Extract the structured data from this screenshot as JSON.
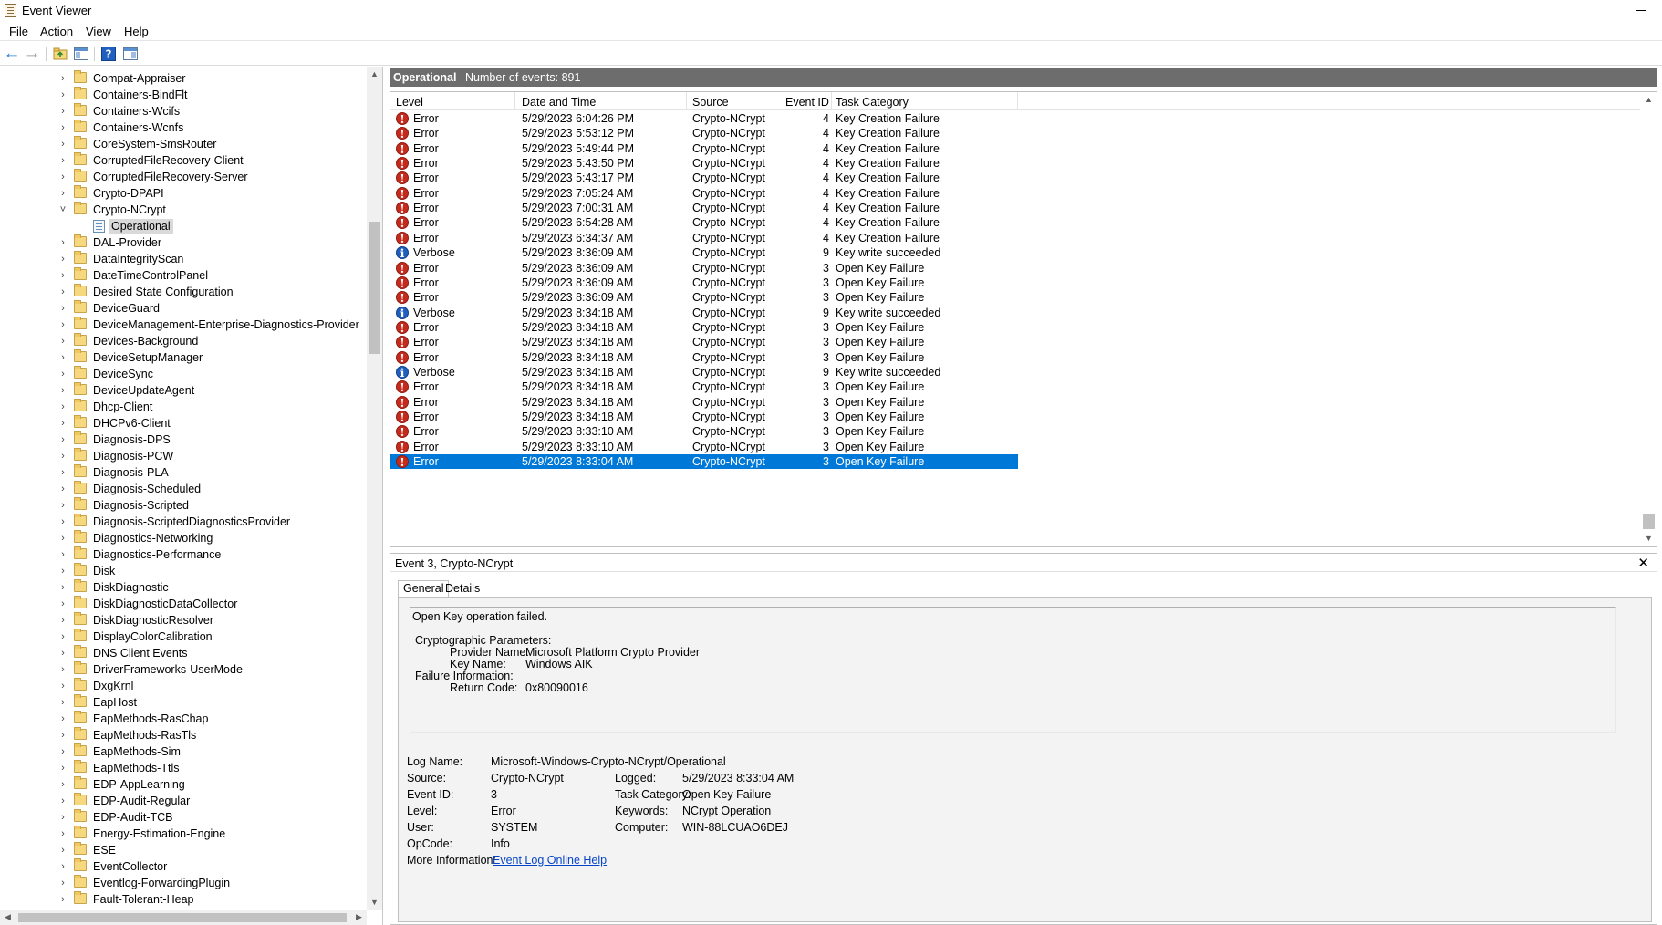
{
  "window": {
    "title": "Event Viewer"
  },
  "menu": [
    "File",
    "Action",
    "View",
    "Help"
  ],
  "toolbar": [
    "back-icon",
    "forward-icon",
    "up-folder-icon",
    "show-hide-tree-icon",
    "help-icon",
    "show-hide-action-pane-icon"
  ],
  "tree": {
    "items": [
      {
        "label": "Compat-Appraiser",
        "expanded": false
      },
      {
        "label": "Containers-BindFlt",
        "expanded": false
      },
      {
        "label": "Containers-Wcifs",
        "expanded": false
      },
      {
        "label": "Containers-Wcnfs",
        "expanded": false
      },
      {
        "label": "CoreSystem-SmsRouter",
        "expanded": false
      },
      {
        "label": "CorruptedFileRecovery-Client",
        "expanded": false
      },
      {
        "label": "CorruptedFileRecovery-Server",
        "expanded": false
      },
      {
        "label": "Crypto-DPAPI",
        "expanded": false
      },
      {
        "label": "Crypto-NCrypt",
        "expanded": true
      },
      {
        "label": "Operational",
        "child": true,
        "selected": true
      },
      {
        "label": "DAL-Provider",
        "expanded": false
      },
      {
        "label": "DataIntegrityScan",
        "expanded": false
      },
      {
        "label": "DateTimeControlPanel",
        "expanded": false
      },
      {
        "label": "Desired State Configuration",
        "expanded": false
      },
      {
        "label": "DeviceGuard",
        "expanded": false
      },
      {
        "label": "DeviceManagement-Enterprise-Diagnostics-Provider",
        "expanded": false
      },
      {
        "label": "Devices-Background",
        "expanded": false
      },
      {
        "label": "DeviceSetupManager",
        "expanded": false
      },
      {
        "label": "DeviceSync",
        "expanded": false
      },
      {
        "label": "DeviceUpdateAgent",
        "expanded": false
      },
      {
        "label": "Dhcp-Client",
        "expanded": false
      },
      {
        "label": "DHCPv6-Client",
        "expanded": false
      },
      {
        "label": "Diagnosis-DPS",
        "expanded": false
      },
      {
        "label": "Diagnosis-PCW",
        "expanded": false
      },
      {
        "label": "Diagnosis-PLA",
        "expanded": false
      },
      {
        "label": "Diagnosis-Scheduled",
        "expanded": false
      },
      {
        "label": "Diagnosis-Scripted",
        "expanded": false
      },
      {
        "label": "Diagnosis-ScriptedDiagnosticsProvider",
        "expanded": false
      },
      {
        "label": "Diagnostics-Networking",
        "expanded": false
      },
      {
        "label": "Diagnostics-Performance",
        "expanded": false
      },
      {
        "label": "Disk",
        "expanded": false
      },
      {
        "label": "DiskDiagnostic",
        "expanded": false
      },
      {
        "label": "DiskDiagnosticDataCollector",
        "expanded": false
      },
      {
        "label": "DiskDiagnosticResolver",
        "expanded": false
      },
      {
        "label": "DisplayColorCalibration",
        "expanded": false
      },
      {
        "label": "DNS Client Events",
        "expanded": false
      },
      {
        "label": "DriverFrameworks-UserMode",
        "expanded": false
      },
      {
        "label": "DxgKrnl",
        "expanded": false
      },
      {
        "label": "EapHost",
        "expanded": false
      },
      {
        "label": "EapMethods-RasChap",
        "expanded": false
      },
      {
        "label": "EapMethods-RasTls",
        "expanded": false
      },
      {
        "label": "EapMethods-Sim",
        "expanded": false
      },
      {
        "label": "EapMethods-Ttls",
        "expanded": false
      },
      {
        "label": "EDP-AppLearning",
        "expanded": false
      },
      {
        "label": "EDP-Audit-Regular",
        "expanded": false
      },
      {
        "label": "EDP-Audit-TCB",
        "expanded": false
      },
      {
        "label": "Energy-Estimation-Engine",
        "expanded": false
      },
      {
        "label": "ESE",
        "expanded": false
      },
      {
        "label": "EventCollector",
        "expanded": false
      },
      {
        "label": "Eventlog-ForwardingPlugin",
        "expanded": false
      },
      {
        "label": "Fault-Tolerant-Heap",
        "expanded": false
      }
    ]
  },
  "log": {
    "name": "Operational",
    "count_label": "Number of events: 891"
  },
  "columns": [
    "Level",
    "Date and Time",
    "Source",
    "Event ID",
    "Task Category"
  ],
  "events": [
    {
      "level": "Error",
      "datetime": "5/29/2023 6:04:26 PM",
      "source": "Crypto-NCrypt",
      "id": "4",
      "task": "Key Creation Failure"
    },
    {
      "level": "Error",
      "datetime": "5/29/2023 5:53:12 PM",
      "source": "Crypto-NCrypt",
      "id": "4",
      "task": "Key Creation Failure"
    },
    {
      "level": "Error",
      "datetime": "5/29/2023 5:49:44 PM",
      "source": "Crypto-NCrypt",
      "id": "4",
      "task": "Key Creation Failure"
    },
    {
      "level": "Error",
      "datetime": "5/29/2023 5:43:50 PM",
      "source": "Crypto-NCrypt",
      "id": "4",
      "task": "Key Creation Failure"
    },
    {
      "level": "Error",
      "datetime": "5/29/2023 5:43:17 PM",
      "source": "Crypto-NCrypt",
      "id": "4",
      "task": "Key Creation Failure"
    },
    {
      "level": "Error",
      "datetime": "5/29/2023 7:05:24 AM",
      "source": "Crypto-NCrypt",
      "id": "4",
      "task": "Key Creation Failure"
    },
    {
      "level": "Error",
      "datetime": "5/29/2023 7:00:31 AM",
      "source": "Crypto-NCrypt",
      "id": "4",
      "task": "Key Creation Failure"
    },
    {
      "level": "Error",
      "datetime": "5/29/2023 6:54:28 AM",
      "source": "Crypto-NCrypt",
      "id": "4",
      "task": "Key Creation Failure"
    },
    {
      "level": "Error",
      "datetime": "5/29/2023 6:34:37 AM",
      "source": "Crypto-NCrypt",
      "id": "4",
      "task": "Key Creation Failure"
    },
    {
      "level": "Verbose",
      "datetime": "5/29/2023 8:36:09 AM",
      "source": "Crypto-NCrypt",
      "id": "9",
      "task": "Key write succeeded"
    },
    {
      "level": "Error",
      "datetime": "5/29/2023 8:36:09 AM",
      "source": "Crypto-NCrypt",
      "id": "3",
      "task": "Open Key Failure"
    },
    {
      "level": "Error",
      "datetime": "5/29/2023 8:36:09 AM",
      "source": "Crypto-NCrypt",
      "id": "3",
      "task": "Open Key Failure"
    },
    {
      "level": "Error",
      "datetime": "5/29/2023 8:36:09 AM",
      "source": "Crypto-NCrypt",
      "id": "3",
      "task": "Open Key Failure"
    },
    {
      "level": "Verbose",
      "datetime": "5/29/2023 8:34:18 AM",
      "source": "Crypto-NCrypt",
      "id": "9",
      "task": "Key write succeeded"
    },
    {
      "level": "Error",
      "datetime": "5/29/2023 8:34:18 AM",
      "source": "Crypto-NCrypt",
      "id": "3",
      "task": "Open Key Failure"
    },
    {
      "level": "Error",
      "datetime": "5/29/2023 8:34:18 AM",
      "source": "Crypto-NCrypt",
      "id": "3",
      "task": "Open Key Failure"
    },
    {
      "level": "Error",
      "datetime": "5/29/2023 8:34:18 AM",
      "source": "Crypto-NCrypt",
      "id": "3",
      "task": "Open Key Failure"
    },
    {
      "level": "Verbose",
      "datetime": "5/29/2023 8:34:18 AM",
      "source": "Crypto-NCrypt",
      "id": "9",
      "task": "Key write succeeded"
    },
    {
      "level": "Error",
      "datetime": "5/29/2023 8:34:18 AM",
      "source": "Crypto-NCrypt",
      "id": "3",
      "task": "Open Key Failure"
    },
    {
      "level": "Error",
      "datetime": "5/29/2023 8:34:18 AM",
      "source": "Crypto-NCrypt",
      "id": "3",
      "task": "Open Key Failure"
    },
    {
      "level": "Error",
      "datetime": "5/29/2023 8:34:18 AM",
      "source": "Crypto-NCrypt",
      "id": "3",
      "task": "Open Key Failure"
    },
    {
      "level": "Error",
      "datetime": "5/29/2023 8:33:10 AM",
      "source": "Crypto-NCrypt",
      "id": "3",
      "task": "Open Key Failure"
    },
    {
      "level": "Error",
      "datetime": "5/29/2023 8:33:10 AM",
      "source": "Crypto-NCrypt",
      "id": "3",
      "task": "Open Key Failure"
    },
    {
      "level": "Error",
      "datetime": "5/29/2023 8:33:04 AM",
      "source": "Crypto-NCrypt",
      "id": "3",
      "task": "Open Key Failure",
      "selected": true
    }
  ],
  "details": {
    "header": "Event 3, Crypto-NCrypt",
    "tabs": [
      "General",
      "Details"
    ],
    "message": {
      "line1": "Open Key operation failed.",
      "section1": "Cryptographic Parameters:",
      "provider_label": "Provider Name:",
      "provider_value": "Microsoft Platform Crypto Provider",
      "keyname_label": "Key Name:",
      "keyname_value": "Windows AIK",
      "section2": "Failure Information:",
      "return_label": "Return Code:",
      "return_value": "0x80090016"
    },
    "props": {
      "log_name_label": "Log Name:",
      "log_name": "Microsoft-Windows-Crypto-NCrypt/Operational",
      "source_label": "Source:",
      "source": "Crypto-NCrypt",
      "logged_label": "Logged:",
      "logged": "5/29/2023 8:33:04 AM",
      "event_id_label": "Event ID:",
      "event_id": "3",
      "task_label": "Task Category:",
      "task": "Open Key Failure",
      "level_label": "Level:",
      "level": "Error",
      "keywords_label": "Keywords:",
      "keywords": "NCrypt Operation",
      "user_label": "User:",
      "user": "SYSTEM",
      "computer_label": "Computer:",
      "computer": "WIN-88LCUAO6DEJ",
      "opcode_label": "OpCode:",
      "opcode": "Info",
      "more_info_label": "More Information:",
      "more_info_link": "Event Log Online Help"
    }
  },
  "colors": {
    "selection": "#0078d7",
    "error": "#c42b1c",
    "info": "#1f5fbf",
    "header": "#6d6d6d",
    "link": "#0645c9"
  }
}
